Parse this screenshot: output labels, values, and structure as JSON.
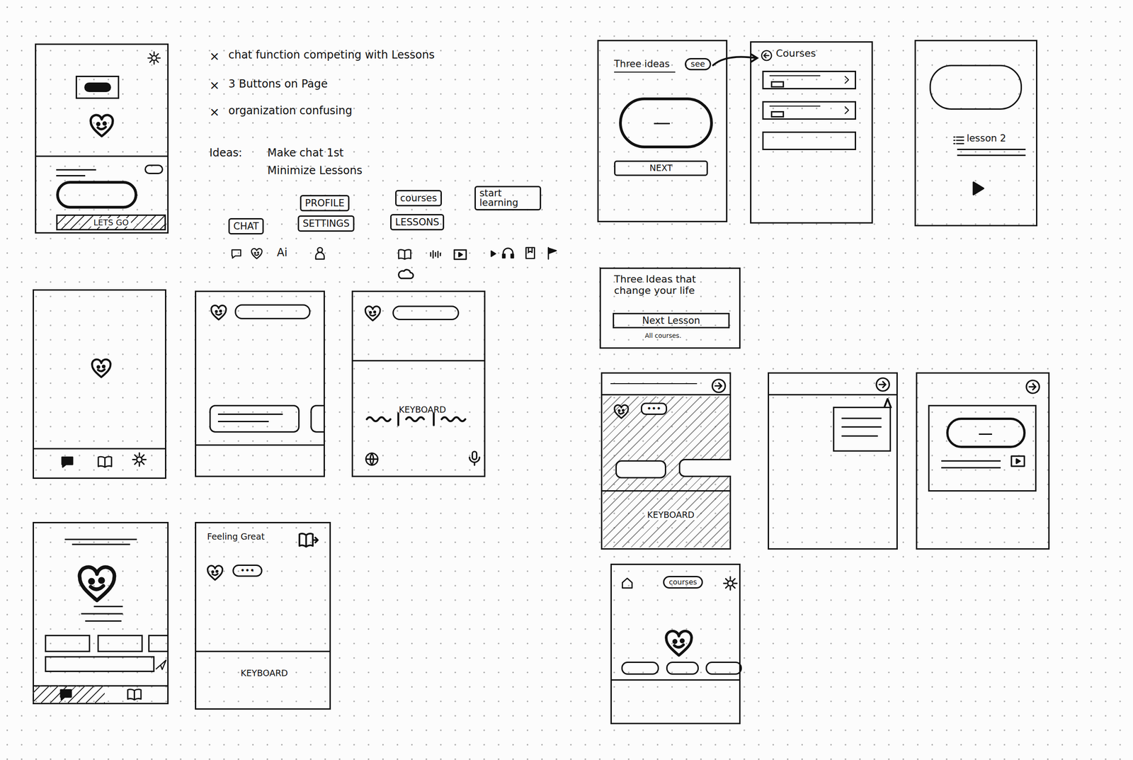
{
  "notes": {
    "problems": [
      {
        "mark": "×",
        "text": "chat function competing with Lessons"
      },
      {
        "mark": "×",
        "text": "3 Buttons on Page"
      },
      {
        "mark": "×",
        "text": "organization confusing"
      }
    ],
    "ideas_label": "Ideas:",
    "ideas": [
      "Make chat 1st",
      "Minimize Lessons"
    ]
  },
  "label_options": [
    {
      "label": "PROFILE"
    },
    {
      "label": "courses"
    },
    {
      "label": "start learning"
    },
    {
      "label": "CHAT"
    },
    {
      "label": "SETTINGS"
    },
    {
      "label": "LESSONS"
    }
  ],
  "icon_row": {
    "ai_label": "Ai"
  },
  "sketch_home": {
    "button": "LETS GO"
  },
  "sketch_chat_keyboard": {
    "keyboard": "KEYBOARD"
  },
  "sketch_feeling": {
    "title": "Feeling Great",
    "typing": "•••",
    "keyboard": "KEYBOARD"
  },
  "sketch_lesson_intro": {
    "title": "Three ideas",
    "see_button": "see",
    "next_button": "NEXT"
  },
  "sketch_courses": {
    "title": "Courses"
  },
  "sketch_lesson_player": {
    "title": "lesson 2"
  },
  "sketch_lesson_card": {
    "title": "Three Ideas that change your life",
    "button": "Next Lesson",
    "link": "All courses."
  },
  "sketch_overlay": {
    "typing": "•••",
    "keyboard": "KEYBOARD"
  },
  "sketch_courses_home": {
    "button": "courses"
  }
}
